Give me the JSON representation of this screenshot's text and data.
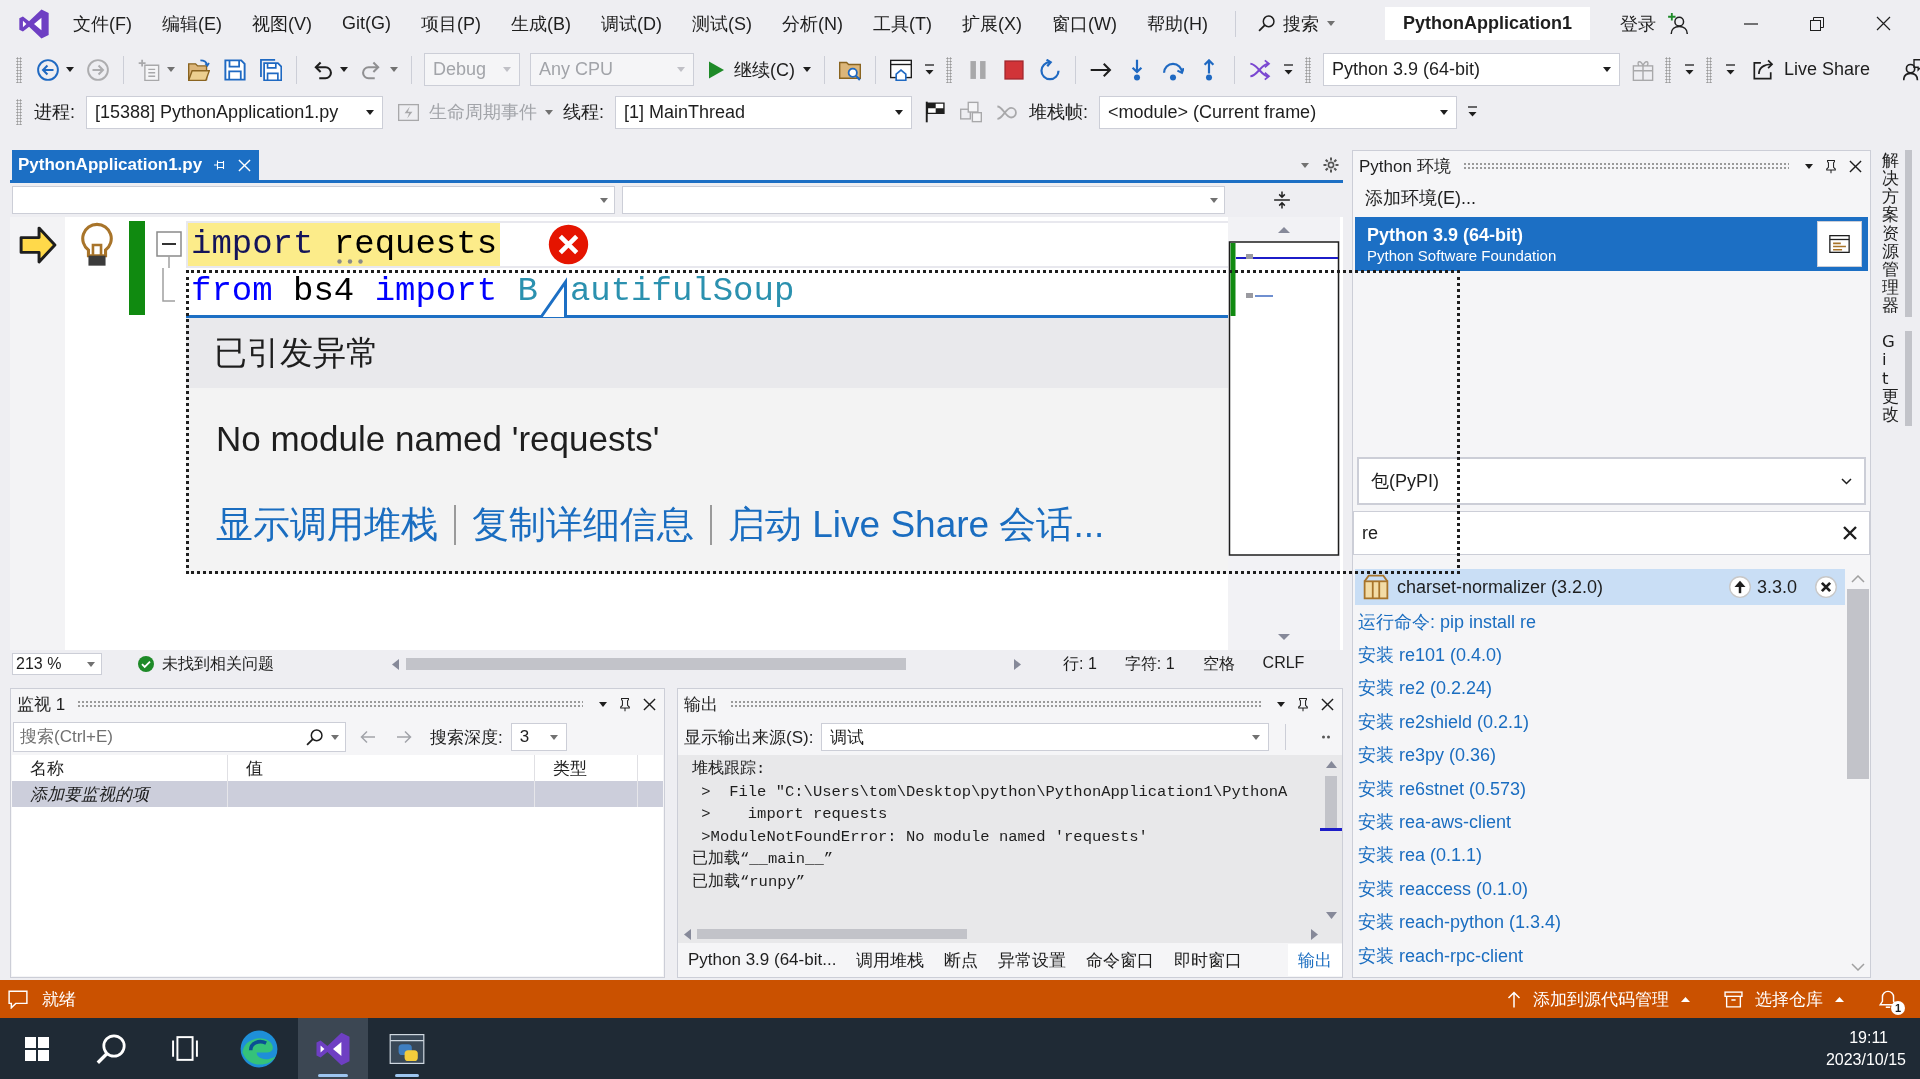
{
  "title_bar": {
    "menu": [
      "文件(F)",
      "编辑(E)",
      "视图(V)",
      "Git(G)",
      "项目(P)",
      "生成(B)",
      "调试(D)",
      "测试(S)",
      "分析(N)",
      "工具(T)",
      "扩展(X)",
      "窗口(W)",
      "帮助(H)"
    ],
    "search": "搜索",
    "solution": "PythonApplication1",
    "sign_in": "登录"
  },
  "toolbar": [
    {
      "grip": true,
      "overflow": false,
      "items": [
        {
          "kind": "back",
          "disabled": false,
          "menu": true
        },
        {
          "kind": "forward",
          "disabled": true,
          "menu": false
        }
      ]
    },
    {
      "grip": false,
      "overflow": false,
      "items": [
        {
          "kind": "newitem",
          "disabled": true,
          "menu": true
        },
        {
          "kind": "open",
          "disabled": false,
          "menu": false
        },
        {
          "kind": "save",
          "disabled": false,
          "menu": false
        },
        {
          "kind": "saveall",
          "disabled": false,
          "menu": false
        }
      ]
    },
    {
      "grip": false,
      "overflow": false,
      "items": [
        {
          "kind": "undo",
          "disabled": false,
          "menu": true
        },
        {
          "kind": "redo",
          "disabled": true,
          "menu": true
        }
      ]
    },
    {
      "grip": false,
      "overflow": false,
      "items": [
        {
          "kind": "combo",
          "value": "Debug",
          "disabled": true,
          "menu": true
        },
        {
          "kind": "combo",
          "value": "Any CPU",
          "disabled": true,
          "menu": true
        },
        {
          "kind": "run",
          "label": "继续(C)",
          "disabled": false,
          "menu": true
        }
      ]
    },
    {
      "grip": false,
      "overflow": false,
      "items": [
        {
          "kind": "findfolder",
          "disabled": false,
          "menu": false
        }
      ]
    },
    {
      "grip": false,
      "overflow": true,
      "items": [
        {
          "kind": "window",
          "disabled": false,
          "menu": false
        }
      ]
    },
    {
      "grip": true,
      "overflow": false,
      "items": [
        {
          "kind": "pause",
          "disabled": true,
          "menu": false
        },
        {
          "kind": "stop",
          "disabled": false,
          "menu": false
        },
        {
          "kind": "restart",
          "disabled": false,
          "menu": false
        }
      ]
    },
    {
      "grip": false,
      "overflow": false,
      "items": [
        {
          "kind": "showstatement",
          "disabled": false,
          "menu": false
        },
        {
          "kind": "stepinto",
          "disabled": false,
          "menu": false
        },
        {
          "kind": "stepover",
          "disabled": false,
          "menu": false
        },
        {
          "kind": "stepout",
          "disabled": false,
          "menu": false
        }
      ]
    },
    {
      "grip": false,
      "overflow": true,
      "items": [
        {
          "kind": "hotreload",
          "disabled": false,
          "menu": false
        }
      ]
    },
    {
      "grip": true,
      "overflow": false,
      "items": [
        {
          "kind": "combo",
          "value": "Python 3.9 (64-bit)",
          "disabled": false,
          "menu": true
        },
        {
          "kind": "gift",
          "disabled": true,
          "menu": false
        }
      ]
    },
    {
      "grip": true,
      "overflow": true
    },
    {
      "grip": true,
      "overflow": true
    },
    {
      "grip": false,
      "overflow": false,
      "items": [
        {
          "kind": "liveshare",
          "label": "Live Share",
          "disabled": false,
          "menu": false
        },
        {
          "kind": "feedback",
          "disabled": false,
          "menu": false
        }
      ]
    }
  ],
  "debug_toolbar": [
    {
      "grip": true,
      "overflow": true,
      "items": [
        {
          "kind": "label",
          "text": "进程:",
          "disabled": false,
          "menu": false
        },
        {
          "kind": "combo",
          "value": "[15388] PythonApplication1.py",
          "disabled": false,
          "menu": true
        },
        {
          "kind": "lifecycle",
          "label": "生命周期事件",
          "disabled": true,
          "menu": true
        },
        {
          "kind": "label",
          "text": "线程:",
          "disabled": false,
          "menu": false
        },
        {
          "kind": "combo",
          "value": "[1] MainThread",
          "disabled": false,
          "menu": true
        },
        {
          "kind": "flag",
          "disabled": false,
          "menu": false
        },
        {
          "kind": "threads",
          "disabled": true,
          "menu": false
        },
        {
          "kind": "expand",
          "disabled": true,
          "menu": false
        },
        {
          "kind": "label",
          "text": "堆栈帧:",
          "disabled": false,
          "menu": false
        },
        {
          "kind": "combo",
          "value": "<module> (Current frame)",
          "disabled": false,
          "menu": true
        }
      ]
    }
  ],
  "document_tabs": [
    {
      "label": "PythonApplication1.py",
      "selected": true
    }
  ],
  "editor": {
    "lines": [
      {
        "kind": "header",
        "expanded": true,
        "current": true,
        "changed": true,
        "lightbulb": true,
        "error": true,
        "parts": [
          {
            "kind": "code",
            "tokens": [
              {
                "kind": "keyword",
                "text": "import ",
                "hint": false
              },
              {
                "kind": "plain",
                "text": "requests",
                "hint": true
              }
            ]
          }
        ]
      },
      {
        "kind": "tail",
        "current": false,
        "changed": true,
        "lightbulb": false,
        "error": false,
        "parts": [
          {
            "kind": "code",
            "tokens": [
              {
                "kind": "keyword",
                "text": "from",
                "hint": false
              },
              {
                "kind": "plain",
                "text": " bs4 ",
                "hint": false
              },
              {
                "kind": "keyword",
                "text": "import",
                "hint": false
              },
              {
                "kind": "type",
                "text": " B",
                "hint": false
              }
            ]
          },
          {
            "kind": "pointer"
          },
          {
            "kind": "code",
            "tokens": [
              {
                "kind": "type",
                "text": "autifulSoup",
                "hint": false
              }
            ]
          }
        ]
      }
    ],
    "exception": {
      "title": "已引发异常",
      "message": "No module named 'requests'",
      "links": [
        "显示调用堆栈",
        "复制详细信息",
        "启动 Live Share 会话..."
      ]
    },
    "status": {
      "zoom": "213 %",
      "issues": "未找到相关问题",
      "indicators": [
        "行: 1",
        "字符: 1",
        "空格",
        "CRLF"
      ]
    }
  },
  "watch_panel": {
    "title": "监视 1",
    "search": {
      "placeholder": "搜索(Ctrl+E)"
    },
    "history": [
      {
        "kind": "back",
        "disabled": true
      },
      {
        "kind": "forward",
        "disabled": true
      }
    ],
    "depth_label": "搜索深度:",
    "depth": "3",
    "columns": [
      "名称",
      "值",
      "类型"
    ],
    "rows": [
      {
        "kind": "placeholder",
        "text": "添加要监视的项",
        "selected": true
      }
    ]
  },
  "output_panel": {
    "title": "输出",
    "source_label": "显示输出来源(S):",
    "source": "调试",
    "lines": [
      "堆栈跟踪:",
      " >  File \"C:\\Users\\tom\\Desktop\\python\\PythonApplication1\\PythonA",
      " >    import requests",
      " >ModuleNotFoundError: No module named 'requests'",
      "已加载“__main__”",
      "已加载“runpy”"
    ],
    "tabs": [
      {
        "label": "Python 3.9 (64-bit...",
        "selected": false
      },
      {
        "label": "调用堆栈",
        "selected": false
      },
      {
        "label": "断点",
        "selected": false
      },
      {
        "label": "异常设置",
        "selected": false
      },
      {
        "label": "命令窗口",
        "selected": false
      },
      {
        "label": "即时窗口",
        "selected": false
      },
      {
        "label": "输出",
        "selected": true
      }
    ]
  },
  "python_environments": {
    "title": "Python 环境",
    "add": "添加环境(E)...",
    "environments": [
      {
        "name": "Python 3.9 (64-bit)",
        "publisher": "Python Software Foundation",
        "selected": true
      }
    ],
    "view": "包(PyPI)",
    "search": {
      "value": "re"
    },
    "packages": [
      {
        "kind": "installed",
        "label": "charset-normalizer (3.2.0)",
        "upgrade": "3.3.0",
        "selected": true
      },
      {
        "kind": "command",
        "label": "运行命令: pip install re",
        "selected": false
      },
      {
        "kind": "install",
        "label": "安装 re101 (0.4.0)",
        "selected": false
      },
      {
        "kind": "install",
        "label": "安装 re2 (0.2.24)",
        "selected": false
      },
      {
        "kind": "install",
        "label": "安装 re2shield (0.2.1)",
        "selected": false
      },
      {
        "kind": "install",
        "label": "安装 re3py (0.36)",
        "selected": false
      },
      {
        "kind": "install",
        "label": "安装 re6stnet (0.573)",
        "selected": false
      },
      {
        "kind": "install",
        "label": "安装 rea-aws-client",
        "selected": false
      },
      {
        "kind": "install",
        "label": "安装 rea (0.1.1)",
        "selected": false
      },
      {
        "kind": "install",
        "label": "安装 reaccess (0.1.0)",
        "selected": false
      },
      {
        "kind": "install",
        "label": "安装 reach-python (1.3.4)",
        "selected": false
      },
      {
        "kind": "install",
        "label": "安装 reach-rpc-client",
        "selected": false
      }
    ]
  },
  "side_tabs": [
    "解决方案资源管理器",
    "Git 更改"
  ],
  "status_bar": {
    "message": "就绪",
    "items": [
      {
        "kind": "publish",
        "label": "添加到源代码管理"
      },
      {
        "kind": "repository",
        "label": "选择仓库"
      }
    ],
    "notifications": "1"
  },
  "taskbar": {
    "apps": [
      {
        "kind": "browser",
        "active": false,
        "running": false
      },
      {
        "kind": "ide",
        "active": true,
        "running": true
      },
      {
        "kind": "python",
        "active": false,
        "running": true
      }
    ],
    "time": "19:11",
    "date": "2023/10/15"
  }
}
